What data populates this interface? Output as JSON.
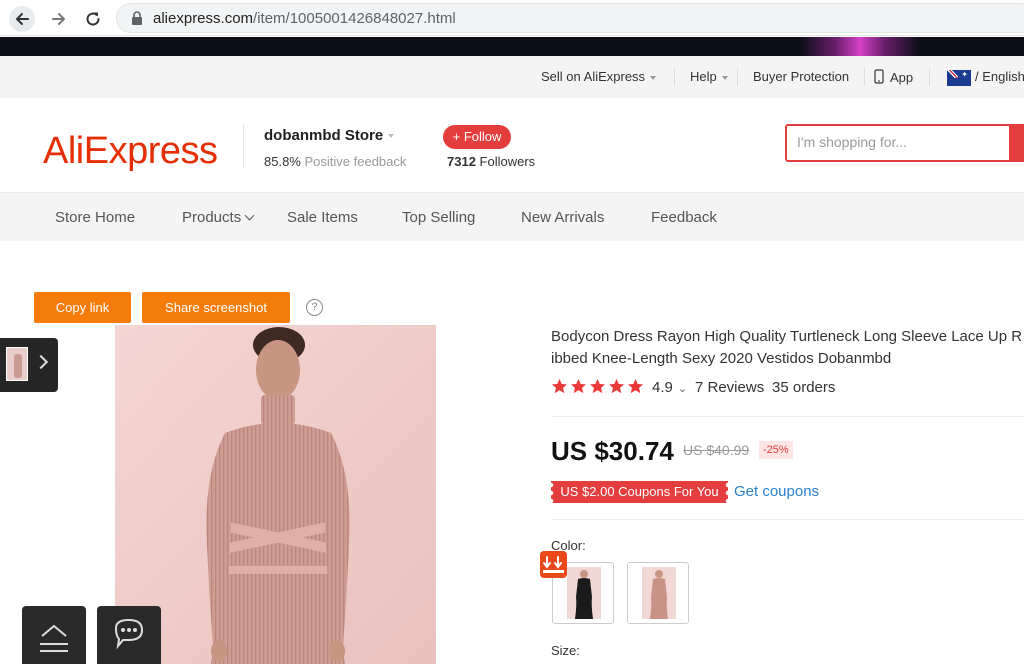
{
  "browser": {
    "url_domain": "aliexpress.com",
    "url_path": "/item/1005001426848027.html"
  },
  "utility_bar": {
    "sell_label": "Sell on AliExpress",
    "help_label": "Help",
    "buyer_protection_label": "Buyer Protection",
    "app_label": "App",
    "language_label": "/ English"
  },
  "header": {
    "logo_text": "AliExpress",
    "store_name": "dobanmbd Store",
    "feedback_percent": "85.8%",
    "feedback_label": "Positive feedback",
    "follow_label": "+ Follow",
    "followers_count": "7312",
    "followers_label": "Followers",
    "search_placeholder": "I'm shopping for..."
  },
  "store_nav": {
    "items": [
      "Store Home",
      "Products",
      "Sale Items",
      "Top Selling",
      "New Arrivals",
      "Feedback"
    ]
  },
  "share": {
    "copy_link_label": "Copy link",
    "share_screenshot_label": "Share screenshot",
    "help_icon_text": "?"
  },
  "product": {
    "title_line1": "Bodycon Dress Rayon High Quality Turtleneck Long Sleeve Lace Up R",
    "title_line2": "ibbed Knee-Length Sexy 2020 Vestidos Dobanmbd",
    "rating": "4.9",
    "rating_stars": 5,
    "reviews": "7 Reviews",
    "orders": "35 orders",
    "price": "US $30.74",
    "original_price": "US $40.99",
    "discount": "-25%",
    "coupon_label": "US $2.00 Coupons For You",
    "get_coupons_label": "Get coupons",
    "color_label": "Color:",
    "size_label": "Size:"
  },
  "colors": {
    "brand_red": "#e43d3d",
    "logo_red": "#e62e04",
    "orange_button": "#f57c0a",
    "link_blue": "#2b80c8",
    "star_red": "#ea3838"
  },
  "icons": [
    "back-arrow-icon",
    "forward-arrow-icon",
    "reload-icon",
    "lock-icon",
    "phone-icon",
    "australia-flag-icon",
    "help-icon",
    "chevron-right-icon",
    "scroll-top-icon",
    "chat-icon",
    "star-icon",
    "hot-badge-icon"
  ]
}
